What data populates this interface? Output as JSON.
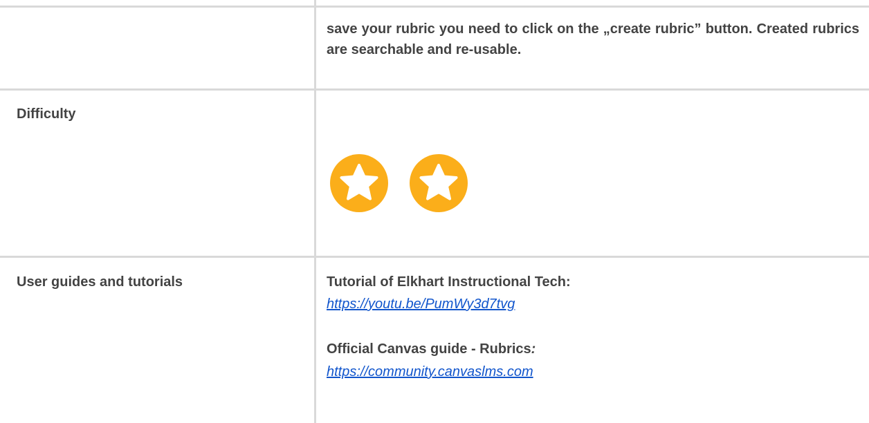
{
  "table": {
    "row1": {
      "description": "save your rubric you need to click on the „create rubric” button. Created rubrics are searchable and re-usable."
    },
    "row2": {
      "label": "Difficulty",
      "rating": {
        "value": 2,
        "icon": "star-icon",
        "color": "#fbae1a"
      }
    },
    "row3": {
      "label": "User guides and tutorials",
      "tutorial_title": "Tutorial of Elkhart Instructional Tech:",
      "tutorial_link": "https://youtu.be/PumWy3d7tvg",
      "guide_title": "Official Canvas guide - Rubrics",
      "guide_colon": ":",
      "guide_link": "https://community.canvaslms.com"
    }
  }
}
